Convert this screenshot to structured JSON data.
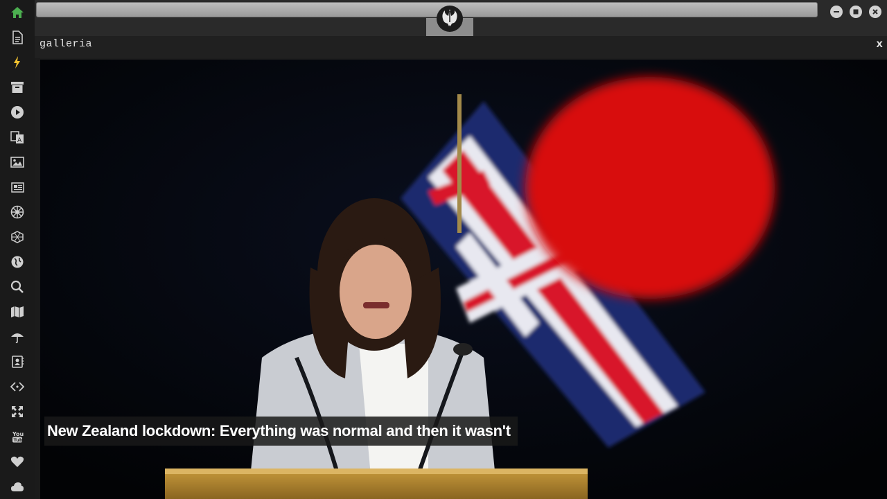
{
  "sidebar": {
    "items": [
      {
        "name": "home-icon",
        "color": "#4caf50"
      },
      {
        "name": "document-icon",
        "color": "#cfcfcf"
      },
      {
        "name": "lightning-icon",
        "color": "#f2c230"
      },
      {
        "name": "archive-icon",
        "color": "#cfcfcf"
      },
      {
        "name": "play-icon",
        "color": "#cfcfcf"
      },
      {
        "name": "translate-icon",
        "color": "#cfcfcf"
      },
      {
        "name": "image-icon",
        "color": "#cfcfcf"
      },
      {
        "name": "newspaper-icon",
        "color": "#cfcfcf"
      },
      {
        "name": "empire-icon",
        "color": "#cfcfcf"
      },
      {
        "name": "hexagon-icon",
        "color": "#cfcfcf"
      },
      {
        "name": "globe-icon",
        "color": "#cfcfcf"
      },
      {
        "name": "search-icon",
        "color": "#cfcfcf"
      },
      {
        "name": "map-icon",
        "color": "#cfcfcf"
      },
      {
        "name": "umbrella-icon",
        "color": "#cfcfcf"
      },
      {
        "name": "contact-book-icon",
        "color": "#cfcfcf"
      },
      {
        "name": "code-icon",
        "color": "#cfcfcf"
      },
      {
        "name": "expand-icon",
        "color": "#cfcfcf"
      },
      {
        "name": "youtube-icon",
        "color": "#cfcfcf"
      },
      {
        "name": "heart-icon",
        "color": "#cfcfcf"
      },
      {
        "name": "cloud-icon",
        "color": "#cfcfcf"
      }
    ]
  },
  "topbar": {
    "logo": "rebel-alliance-logo"
  },
  "panel": {
    "title": "galleria",
    "close_label": "x"
  },
  "gallery": {
    "caption": "New Zealand lockdown: Everything was normal and then it wasn't"
  }
}
